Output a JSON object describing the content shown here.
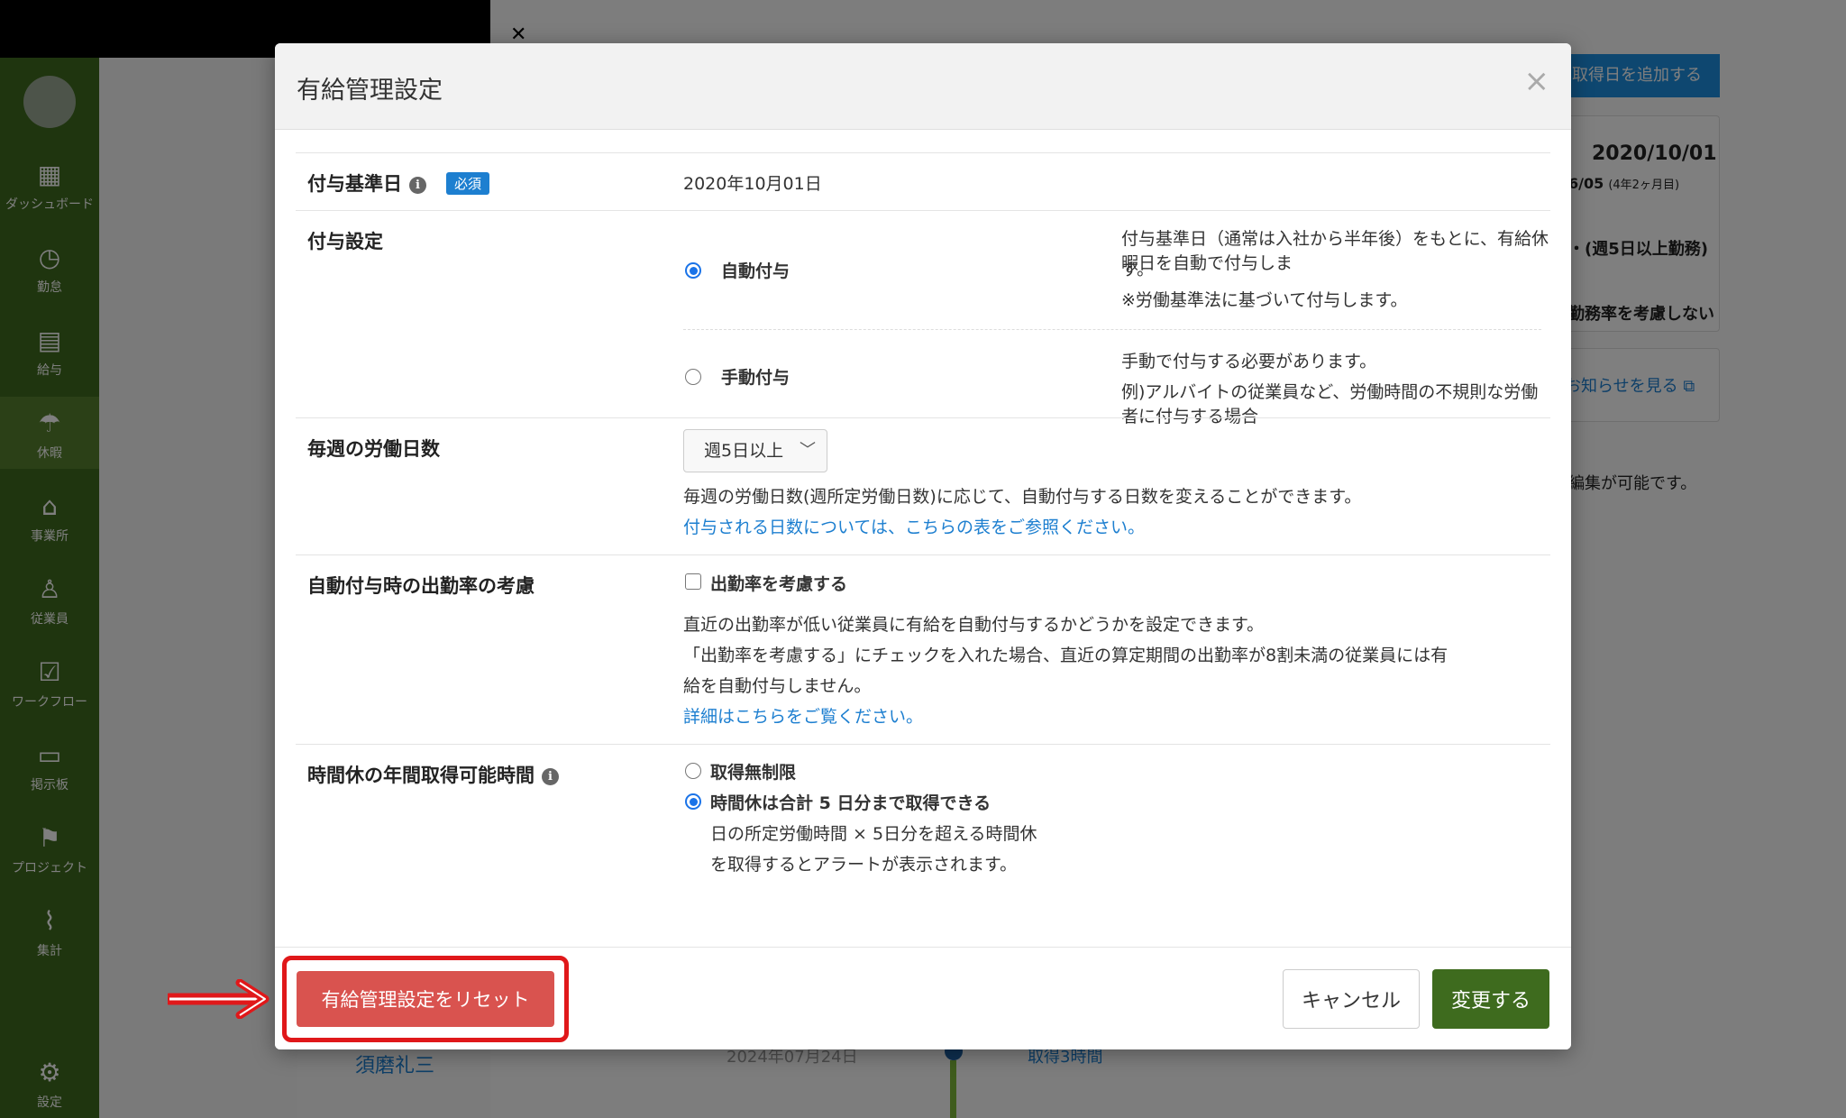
{
  "sidebar": {
    "items": [
      {
        "label": "ダッシュボード",
        "icon": "dashboard-icon"
      },
      {
        "label": "勤怠",
        "icon": "clock-icon"
      },
      {
        "label": "給与",
        "icon": "calculator-icon"
      },
      {
        "label": "休暇",
        "icon": "umbrella-icon"
      },
      {
        "label": "事業所",
        "icon": "home-icon"
      },
      {
        "label": "従業員",
        "icon": "person-icon"
      },
      {
        "label": "ワークフロー",
        "icon": "checklist-icon"
      },
      {
        "label": "掲示板",
        "icon": "message-icon"
      },
      {
        "label": "プロジェクト",
        "icon": "flag-icon"
      },
      {
        "label": "集計",
        "icon": "chart-icon"
      }
    ],
    "settings_label": "設定"
  },
  "background": {
    "add_button": "取得日を追加する",
    "card_date": "2020/10/01",
    "card_sub_date": "6/05",
    "card_sub_note": "(4年2ヶ月目)",
    "card_line1": "・(週5日以上勤務)",
    "card_line2": "勤務率を考慮しない",
    "notice_link": "お知らせを見る",
    "note": "編集が可能です。",
    "employee_name": "須磨礼三",
    "employee_date": "2024年07月24日",
    "employee_time": "取得3時間"
  },
  "modal": {
    "title": "有給管理設定",
    "close": "×",
    "grant_base_date": {
      "label": "付与基準日",
      "required": "必須",
      "value": "2020年10月01日"
    },
    "grant_setting": {
      "label": "付与設定",
      "auto": {
        "label": "自動付与",
        "desc_1": "付与基準日（通常は入社から半年後）をもとに、有給休暇日を自動で付与しま",
        "desc_2": "す。",
        "desc_3": "※労働基準法に基づいて付与します。"
      },
      "manual": {
        "label": "手動付与",
        "desc_1": "手動で付与する必要があります。",
        "desc_2": "例)アルバイトの従業員など、労働時間の不規則な労働者に付与する場合"
      }
    },
    "weekly_days": {
      "label": "毎週の労働日数",
      "selected": "週5日以上",
      "desc": "毎週の労働日数(週所定労働日数)に応じて、自動付与する日数を変えることができます。",
      "link": "付与される日数については、こちらの表をご参照ください。"
    },
    "attendance": {
      "label": "自動付与時の出勤率の考慮",
      "checkbox_label": "出勤率を考慮する",
      "desc_1": "直近の出勤率が低い従業員に有給を自動付与するかどうかを設定できます。",
      "desc_2": "「出勤率を考慮する」にチェックを入れた場合、直近の算定期間の出勤率が8割未満の従業員には有",
      "desc_3": "給を自動付与しません。",
      "link": "詳細はこちらをご覧ください。"
    },
    "hourly_leave": {
      "label": "時間休の年間取得可能時間",
      "option_unlimited": "取得無制限",
      "option_limited": "時間休は合計 5 日分まで取得できる",
      "desc_1": "日の所定労働時間 × 5日分を超える時間休",
      "desc_2": "を取得するとアラートが表示されます。"
    },
    "footer": {
      "reset": "有給管理設定をリセット",
      "cancel": "キャンセル",
      "submit": "変更する"
    }
  }
}
